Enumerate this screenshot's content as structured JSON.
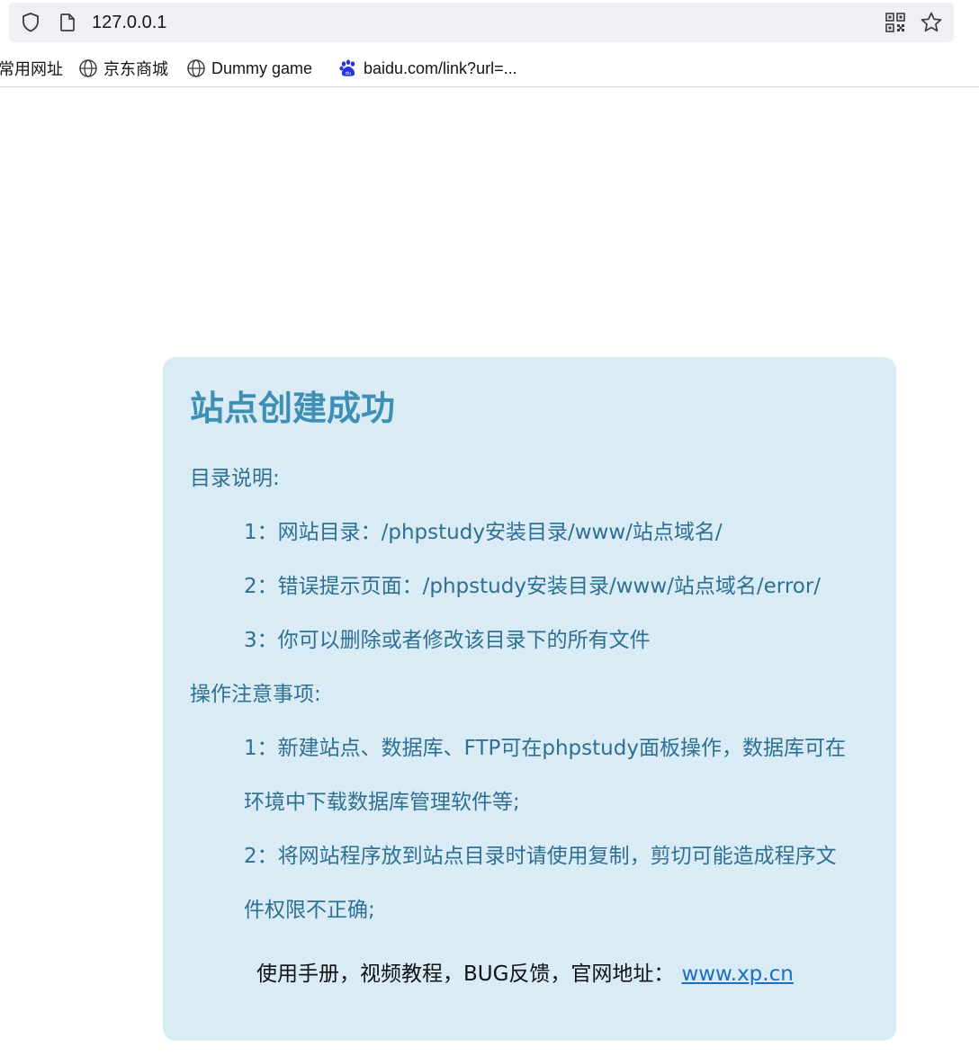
{
  "browser": {
    "url": "127.0.0.1",
    "icons": {
      "shield": "shield-icon",
      "page": "page-icon",
      "qr": "qr-code-icon",
      "star": "bookmark-star-icon"
    },
    "bookmarks": [
      {
        "label": "常用网址",
        "icon": "none"
      },
      {
        "label": "京东商城",
        "icon": "globe-icon"
      },
      {
        "label": "Dummy game",
        "icon": "globe-icon"
      },
      {
        "label": "baidu.com/link?url=...",
        "icon": "baidu-paw-icon"
      }
    ]
  },
  "page": {
    "title": "站点创建成功",
    "sections": [
      {
        "heading": "目录说明:",
        "items": [
          "1：网站目录：/phpstudy安装目录/www/站点域名/",
          "2：错误提示页面：/phpstudy安装目录/www/站点域名/error/",
          "3：你可以删除或者修改该目录下的所有文件"
        ]
      },
      {
        "heading": "操作注意事项:",
        "items": [
          "1：新建站点、数据库、FTP可在phpstudy面板操作，数据库可在",
          "环境中下载数据库管理软件等;",
          "2：将网站程序放到站点目录时请使用复制，剪切可能造成程序文",
          "件权限不正确;"
        ]
      }
    ],
    "footer": {
      "text": "使用手册，视频教程，BUG反馈，官网地址：",
      "link": "www.xp.cn"
    },
    "colors": {
      "card_background": "#d9ecf6",
      "title": "#3f8fb5",
      "text": "#2f6f92",
      "link": "#1a6fc4"
    }
  }
}
